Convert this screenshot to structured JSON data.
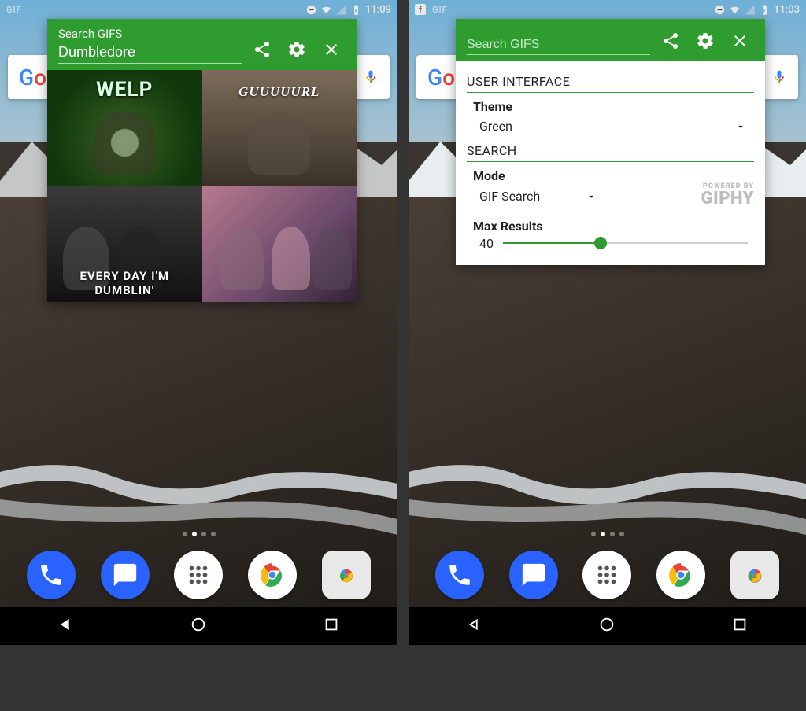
{
  "left": {
    "statusbar": {
      "gif_label": "GIF",
      "time": "11:09",
      "has_fb": false
    },
    "widget": {
      "search_label": "Search GIFS",
      "search_value": "Dumbledore",
      "gifs": [
        {
          "caption": "WELP"
        },
        {
          "caption": "GUUUUURL"
        },
        {
          "caption": "EVERY DAY I'M DUMBLIN'"
        },
        {
          "caption": ""
        }
      ]
    }
  },
  "right": {
    "statusbar": {
      "gif_label": "GIF",
      "time": "11:03",
      "has_fb": true
    },
    "widget": {
      "search_label": "Search GIFS",
      "search_value": "",
      "settings": {
        "section_ui": "USER INTERFACE",
        "theme_label": "Theme",
        "theme_value": "Green",
        "section_search": "SEARCH",
        "mode_label": "Mode",
        "mode_value": "GIF Search",
        "giphy_line1": "POWERED BY",
        "giphy_line2": "GIPHY",
        "max_results_label": "Max Results",
        "max_results_value": "40",
        "max_results_percent": 40
      }
    }
  },
  "google_logo": "Google"
}
